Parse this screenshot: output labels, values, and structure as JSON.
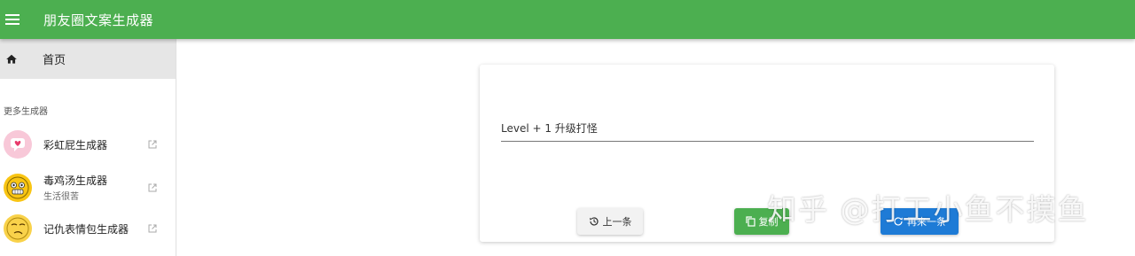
{
  "appbar": {
    "title": "朋友圈文案生成器",
    "menu_icon": "menu-icon"
  },
  "sidebar": {
    "home": {
      "label": "首页",
      "icon": "home-icon"
    },
    "section_title": "更多生成器",
    "items": [
      {
        "name": "彩虹屁生成器",
        "subtitle": "",
        "icon": "heart-speech-emoji-icon",
        "link_icon": "external-link-icon"
      },
      {
        "name": "毒鸡汤生成器",
        "subtitle": "生活很苦",
        "icon": "grimace-emoji-icon",
        "link_icon": "external-link-icon"
      },
      {
        "name": "记仇表情包生成器",
        "subtitle": "",
        "icon": "smirk-emoji-icon",
        "link_icon": "external-link-icon"
      }
    ]
  },
  "main": {
    "text_value": "Level + 1 升级打怪",
    "buttons": {
      "prev": "上一条",
      "copy": "复制",
      "next": "再来一条"
    }
  },
  "watermark": "知乎 @打工小鱼不摸鱼",
  "colors": {
    "primary": "#4caf50",
    "next_button": "#1e7bd6"
  }
}
